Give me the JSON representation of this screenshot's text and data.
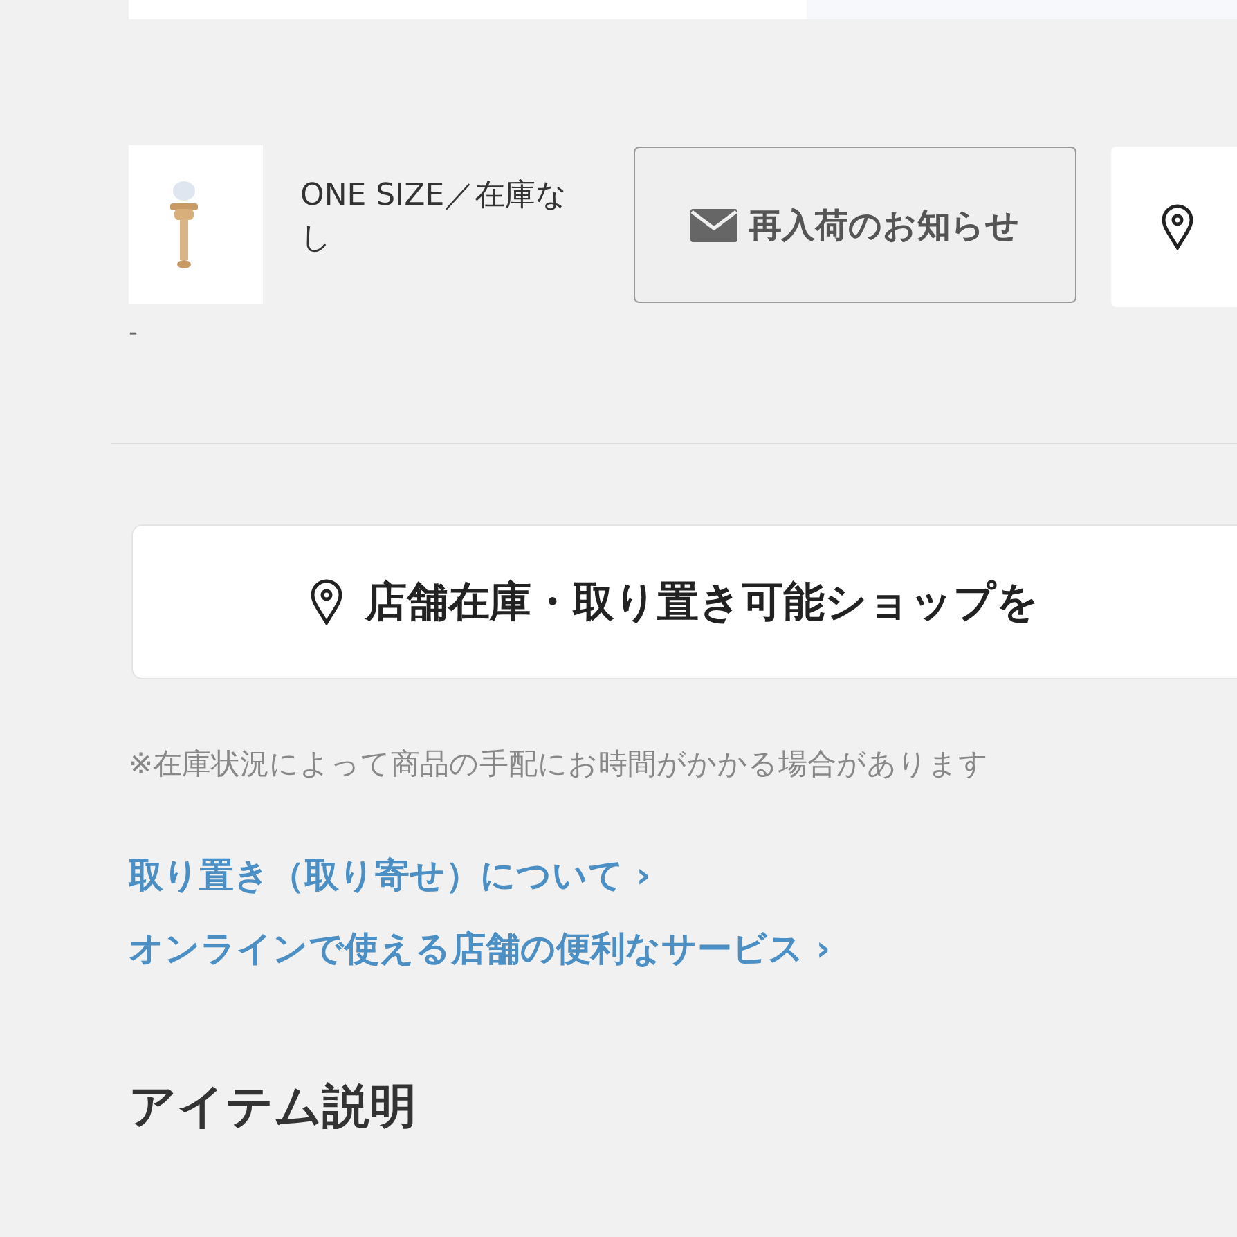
{
  "variant": {
    "kind": "picture",
    "label": "ONE SIZE／在庫なし",
    "restock_button": "再入荷のお知らせ",
    "note": "-"
  },
  "store_search_button": "店舗在庫・取り置き可能ショップを",
  "notice": "※在庫状況によって商品の手配にお時間がかかる場合があります",
  "links": [
    "取り置き（取り寄せ）について ›",
    "オンラインで使える店舗の便利なサービス ›"
  ],
  "section_heading": "アイテム説明"
}
